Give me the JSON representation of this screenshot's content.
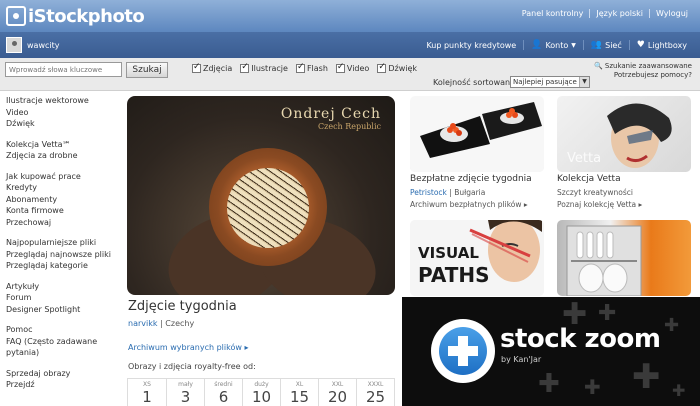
{
  "header": {
    "logo_text": "iStockphoto",
    "nav": [
      "Panel kontrolny",
      "Język polski",
      "Wyloguj"
    ]
  },
  "userbar": {
    "username": "wawcity",
    "buy_credits": "Kup punkty kredytowe",
    "account": "Konto",
    "network": "Sieć",
    "lightbox": "Lightboxy"
  },
  "search": {
    "placeholder": "Wprowadź słowa kluczowe",
    "button_label": "Szukaj",
    "filters": [
      {
        "label": "Zdjęcia",
        "checked": true
      },
      {
        "label": "Ilustracje",
        "checked": true
      },
      {
        "label": "Flash",
        "checked": true
      },
      {
        "label": "Video",
        "checked": true
      },
      {
        "label": "Dźwięk",
        "checked": true
      }
    ],
    "advanced_search": "Szukanie zaawansowane",
    "help": "Potrzebujesz pomocy?",
    "sort_label": "Kolejność sortowania",
    "sort_value": "Najlepiej pasujące"
  },
  "sidebar": {
    "groups": [
      [
        "Ilustracje wektorowe",
        "Video",
        "Dźwięk"
      ],
      [
        "Kolekcja Vetta℠",
        "Zdjęcia za drobne"
      ],
      [
        "Jak kupować prace",
        "Kredyty",
        "Abonamenty",
        "Konta firmowe",
        "Przechowaj"
      ],
      [
        "Najpopularniejsze pliki",
        "Przeglądaj najnowsze pliki",
        "Przeglądaj kategorie"
      ],
      [
        "Artykuły",
        "Forum",
        "Designer Spotlight"
      ],
      [
        "Pomoc",
        "FAQ (Często zadawane",
        "pytania)"
      ],
      [
        "Sprzedaj obrazy",
        "Przejdź"
      ]
    ]
  },
  "featured": {
    "photographer_name": "Ondrej Cech",
    "photographer_country": "Czech Republic",
    "title": "Zdjęcie tygodnia",
    "author": "narvikk",
    "country": "Czechy",
    "archive_link": "Archiwum wybranych plików",
    "royalty_label": "Obrazy i zdjęcia royalty-free od:",
    "sizes": [
      {
        "label": "XS",
        "credits": "1"
      },
      {
        "label": "mały",
        "credits": "3"
      },
      {
        "label": "średni",
        "credits": "6"
      },
      {
        "label": "duży",
        "credits": "10"
      },
      {
        "label": "XL",
        "credits": "15"
      },
      {
        "label": "XXL",
        "credits": "20"
      },
      {
        "label": "XXXL",
        "credits": "25"
      }
    ]
  },
  "tiles": {
    "free": {
      "title": "Bezpłatne zdjęcie tygodnia",
      "author": "Petristock",
      "country": "Bułgaria",
      "archive_link": "Archiwum bezpłatnych plików"
    },
    "vetta": {
      "title": "Kolekcja Vetta",
      "line": "Szczyt kreatywności",
      "link": "Poznaj kolekcję Vetta",
      "image_text": "Vetta"
    },
    "visual": {
      "line1": "VISUAL",
      "line2": "PATHS"
    }
  },
  "stockzoom": {
    "title": "stock zoom",
    "subtitle": "by Kan'Jar"
  }
}
